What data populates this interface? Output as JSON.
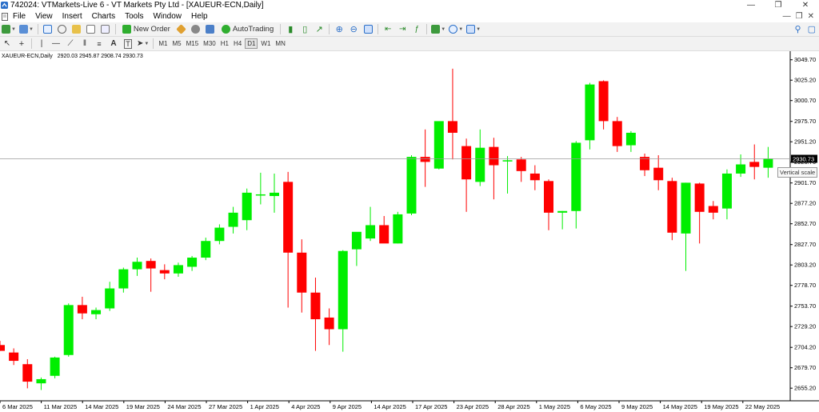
{
  "window": {
    "title": "742024: VTMarkets-Live 6 - VT Markets Pty Ltd - [XAUEUR-ECN,Daily]",
    "controls": [
      "—",
      "❐",
      "✕"
    ]
  },
  "menu": {
    "items": [
      "File",
      "View",
      "Insert",
      "Charts",
      "Tools",
      "Window",
      "Help"
    ],
    "right_controls": [
      "—",
      "❐",
      "✕"
    ]
  },
  "toolbar": {
    "new_order_label": "New Order",
    "autotrading_label": "AutoTrading",
    "timeframes": [
      "M1",
      "M5",
      "M15",
      "M30",
      "H1",
      "H4",
      "D1",
      "W1",
      "MN"
    ],
    "active_timeframe": "D1"
  },
  "chart_info": {
    "symbol": "XAUEUR-ECN,Daily",
    "ohlc": "2920.03 2945.87 2908.74 2930.73"
  },
  "tooltip": "Vertical scale",
  "chart_data": {
    "type": "candlestick",
    "symbol": "XAUEUR-ECN",
    "timeframe": "Daily",
    "current_price": "2930.73",
    "ylim": [
      2640,
      3060
    ],
    "y_ticks": [
      "3049.70",
      "3025.20",
      "3000.70",
      "2975.70",
      "2951.20",
      "2926.70",
      "2901.70",
      "2877.20",
      "2852.70",
      "2827.70",
      "2803.20",
      "2778.70",
      "2753.70",
      "2729.20",
      "2704.20",
      "2679.70",
      "2655.20"
    ],
    "x_labels": [
      "6 Mar 2025",
      "11 Mar 2025",
      "14 Mar 2025",
      "19 Mar 2025",
      "24 Mar 2025",
      "27 Mar 2025",
      "1 Apr 2025",
      "4 Apr 2025",
      "9 Apr 2025",
      "14 Apr 2025",
      "17 Apr 2025",
      "23 Apr 2025",
      "28 Apr 2025",
      "1 May 2025",
      "6 May 2025",
      "9 May 2025",
      "14 May 2025",
      "19 May 2025",
      "22 May 2025"
    ],
    "up_color": "#00ee00",
    "down_color": "#ff0000",
    "candles": [
      {
        "o": 2707,
        "h": 2712,
        "l": 2700,
        "c": 2700
      },
      {
        "o": 2698,
        "h": 2703,
        "l": 2683,
        "c": 2688
      },
      {
        "o": 2684,
        "h": 2690,
        "l": 2655,
        "c": 2663
      },
      {
        "o": 2661,
        "h": 2668,
        "l": 2653,
        "c": 2666
      },
      {
        "o": 2670,
        "h": 2693,
        "l": 2667,
        "c": 2692
      },
      {
        "o": 2695,
        "h": 2757,
        "l": 2693,
        "c": 2755
      },
      {
        "o": 2755,
        "h": 2765,
        "l": 2738,
        "c": 2745
      },
      {
        "o": 2744,
        "h": 2752,
        "l": 2738,
        "c": 2749
      },
      {
        "o": 2751,
        "h": 2783,
        "l": 2748,
        "c": 2775
      },
      {
        "o": 2775,
        "h": 2800,
        "l": 2770,
        "c": 2798
      },
      {
        "o": 2798,
        "h": 2812,
        "l": 2790,
        "c": 2807
      },
      {
        "o": 2808,
        "h": 2811,
        "l": 2771,
        "c": 2799
      },
      {
        "o": 2797,
        "h": 2804,
        "l": 2786,
        "c": 2793
      },
      {
        "o": 2793,
        "h": 2806,
        "l": 2789,
        "c": 2803
      },
      {
        "o": 2801,
        "h": 2814,
        "l": 2796,
        "c": 2812
      },
      {
        "o": 2812,
        "h": 2836,
        "l": 2809,
        "c": 2832
      },
      {
        "o": 2832,
        "h": 2852,
        "l": 2828,
        "c": 2848
      },
      {
        "o": 2849,
        "h": 2873,
        "l": 2841,
        "c": 2866
      },
      {
        "o": 2857,
        "h": 2895,
        "l": 2845,
        "c": 2890
      },
      {
        "o": 2888,
        "h": 2914,
        "l": 2876,
        "c": 2888
      },
      {
        "o": 2886,
        "h": 2913,
        "l": 2866,
        "c": 2890
      },
      {
        "o": 2903,
        "h": 2915,
        "l": 2752,
        "c": 2818
      },
      {
        "o": 2818,
        "h": 2834,
        "l": 2746,
        "c": 2770
      },
      {
        "o": 2770,
        "h": 2788,
        "l": 2700,
        "c": 2738
      },
      {
        "o": 2740,
        "h": 2751,
        "l": 2707,
        "c": 2726
      },
      {
        "o": 2726,
        "h": 2821,
        "l": 2699,
        "c": 2820
      },
      {
        "o": 2822,
        "h": 2841,
        "l": 2802,
        "c": 2843
      },
      {
        "o": 2835,
        "h": 2873,
        "l": 2832,
        "c": 2851
      },
      {
        "o": 2851,
        "h": 2862,
        "l": 2830,
        "c": 2829
      },
      {
        "o": 2829,
        "h": 2867,
        "l": 2829,
        "c": 2864
      },
      {
        "o": 2865,
        "h": 2935,
        "l": 2863,
        "c": 2933
      },
      {
        "o": 2933,
        "h": 2966,
        "l": 2897,
        "c": 2927
      },
      {
        "o": 2919,
        "h": 2975,
        "l": 2918,
        "c": 2976
      },
      {
        "o": 2976,
        "h": 3039,
        "l": 2930,
        "c": 2962
      },
      {
        "o": 2946,
        "h": 2955,
        "l": 2867,
        "c": 2906
      },
      {
        "o": 2903,
        "h": 2966,
        "l": 2898,
        "c": 2944
      },
      {
        "o": 2945,
        "h": 2956,
        "l": 2882,
        "c": 2923
      },
      {
        "o": 2929,
        "h": 2934,
        "l": 2889,
        "c": 2929
      },
      {
        "o": 2930,
        "h": 2933,
        "l": 2903,
        "c": 2916
      },
      {
        "o": 2913,
        "h": 2923,
        "l": 2893,
        "c": 2905
      },
      {
        "o": 2904,
        "h": 2906,
        "l": 2845,
        "c": 2866
      },
      {
        "o": 2866,
        "h": 2868,
        "l": 2846,
        "c": 2868
      },
      {
        "o": 2868,
        "h": 2952,
        "l": 2847,
        "c": 2950
      },
      {
        "o": 2953,
        "h": 3022,
        "l": 2942,
        "c": 3020
      },
      {
        "o": 3024,
        "h": 3025,
        "l": 2966,
        "c": 2976
      },
      {
        "o": 2976,
        "h": 2981,
        "l": 2939,
        "c": 2946
      },
      {
        "o": 2947,
        "h": 2964,
        "l": 2939,
        "c": 2962
      },
      {
        "o": 2933,
        "h": 2937,
        "l": 2910,
        "c": 2917
      },
      {
        "o": 2920,
        "h": 2935,
        "l": 2893,
        "c": 2905
      },
      {
        "o": 2904,
        "h": 2908,
        "l": 2833,
        "c": 2842
      },
      {
        "o": 2841,
        "h": 2902,
        "l": 2796,
        "c": 2902
      },
      {
        "o": 2901,
        "h": 2902,
        "l": 2829,
        "c": 2867
      },
      {
        "o": 2874,
        "h": 2880,
        "l": 2858,
        "c": 2866
      },
      {
        "o": 2871,
        "h": 2918,
        "l": 2858,
        "c": 2913
      },
      {
        "o": 2913,
        "h": 2936,
        "l": 2909,
        "c": 2924
      },
      {
        "o": 2927,
        "h": 2948,
        "l": 2906,
        "c": 2921
      },
      {
        "o": 2920,
        "h": 2945,
        "l": 2908,
        "c": 2931
      }
    ]
  }
}
